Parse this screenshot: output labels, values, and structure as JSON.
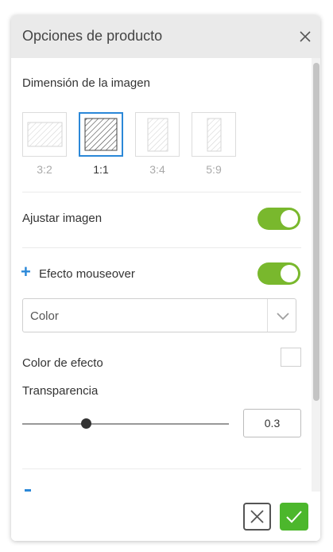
{
  "header": {
    "title": "Opciones de producto"
  },
  "image_dimension": {
    "label": "Dimensión de la imagen",
    "options": [
      {
        "label": "3:2",
        "selected": false
      },
      {
        "label": "1:1",
        "selected": true
      },
      {
        "label": "3:4",
        "selected": false
      },
      {
        "label": "5:9",
        "selected": false
      }
    ]
  },
  "fit_image": {
    "label": "Ajustar imagen",
    "enabled": true
  },
  "mouseover": {
    "label": "Efecto mouseover",
    "enabled": true
  },
  "effect_type": {
    "selected": "Color"
  },
  "effect_color": {
    "label": "Color de efecto",
    "value": "#ffffff"
  },
  "transparency": {
    "label": "Transparencia",
    "value": "0.3",
    "slider_fraction": 0.3
  },
  "colors": {
    "accent": "#2b88d8",
    "toggle_on": "#79b82d",
    "confirm": "#4cb72c"
  }
}
